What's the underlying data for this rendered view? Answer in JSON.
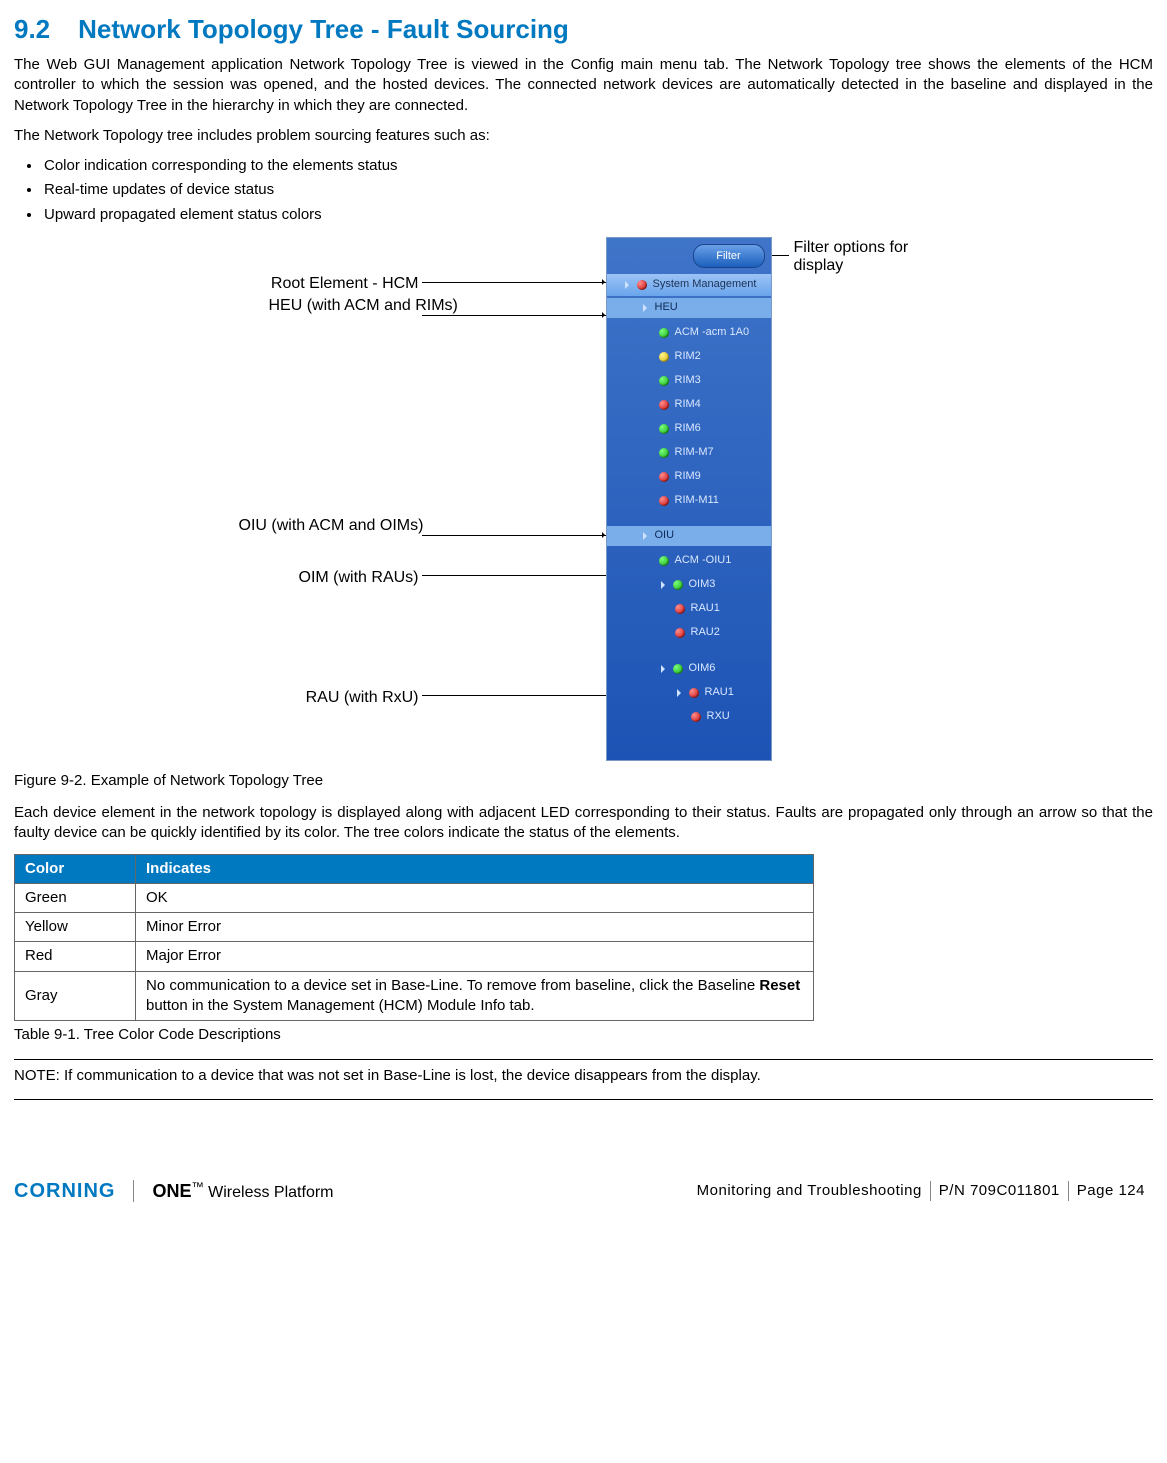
{
  "heading": {
    "num": "9.2",
    "title": "Network Topology Tree - Fault Sourcing"
  },
  "para1": "The Web GUI Management application Network Topology Tree is viewed in the Config main menu tab. The Network Topology tree shows the elements of the HCM controller to which the session was opened, and the hosted devices. The connected network devices are automatically detected in the baseline and displayed in the Network Topology Tree in the hierarchy in which they are connected.",
  "para2": "The Network Topology tree includes problem sourcing features such as:",
  "bullets": [
    "Color indication corresponding to the elements status",
    "Real-time updates of device status",
    "Upward propagated element status colors"
  ],
  "figure": {
    "filter": "Filter",
    "callouts": {
      "root": "Root Element - HCM",
      "heu": "HEU (with ACM and RIMs)",
      "oiu": "OIU (with ACM and OIMs)",
      "oim": "OIM (with RAUs)",
      "rau": "RAU (with RxU)",
      "filter": "Filter options for display"
    },
    "tree": {
      "sysmgmt": "System Management",
      "heu": "HEU",
      "acm1": "ACM -acm 1A0",
      "rim2": "RIM2",
      "rim3": "RIM3",
      "rim4": "RIM4",
      "rim6": "RIM6",
      "rimm7": "RIM-M7",
      "rim9": "RIM9",
      "rimm11": "RIM-M11",
      "oiu": "OIU",
      "acmoiu1": "ACM -OIU1",
      "oim3": "OIM3",
      "rau1": "RAU1",
      "rau2": "RAU2",
      "oim6": "OIM6",
      "rau1b": "RAU1",
      "rxu": "RXU"
    }
  },
  "fig_caption": "Figure 9-2. Example of Network Topology Tree",
  "para3": "Each device element in the network topology is displayed along with adjacent LED corresponding to their status. Faults are propagated only through an arrow so that the faulty device can be quickly identified by its color. The tree colors indicate the status of the elements.",
  "table": {
    "h1": "Color",
    "h2": "Indicates",
    "rows": [
      {
        "c": "Green",
        "d": "OK"
      },
      {
        "c": "Yellow",
        "d": "Minor Error"
      },
      {
        "c": "Red",
        "d": "Major Error"
      },
      {
        "c": "Gray",
        "d_pre": "No communication to a device set in Base-Line. To remove from baseline, click the Baseline ",
        "d_bold": "Reset",
        "d_post": " button in the System Management (HCM) Module Info tab."
      }
    ]
  },
  "tbl_caption": "Table 9-1. Tree Color Code Descriptions",
  "note": "NOTE: If communication to a device that was not set in Base-Line is lost, the device disappears from the display.",
  "footer": {
    "corning": "CORNING",
    "one": "ONE",
    "wp": "Wireless Platform",
    "section": "Monitoring and Troubleshooting",
    "pn": "P/N 709C011801",
    "page": "Page 124"
  }
}
